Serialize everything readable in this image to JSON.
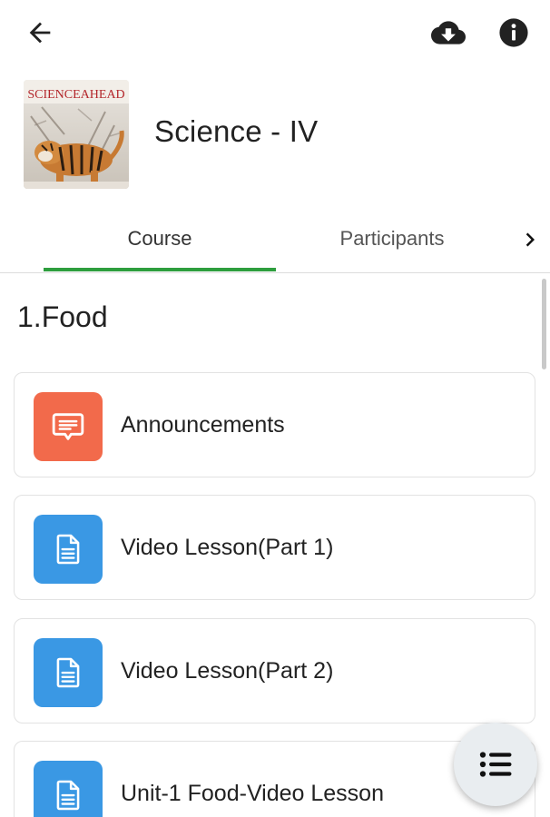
{
  "topbar": {
    "back_icon": "arrow-left-icon",
    "download_icon": "cloud-download-icon",
    "info_icon": "info-circle-icon"
  },
  "course": {
    "title": "Science - IV",
    "thumbnail_text": "SCIENCEAHEAD",
    "thumbnail_icon": "course-cover-image"
  },
  "tabs": {
    "items": [
      {
        "label": "Course",
        "active": true
      },
      {
        "label": "Participants",
        "active": false
      }
    ],
    "next_icon": "chevron-right-icon",
    "accent": "#2e9e3e"
  },
  "section": {
    "title": "1.Food"
  },
  "activities": [
    {
      "label": "Announcements",
      "icon": "forum-icon",
      "color": "#f26a4b"
    },
    {
      "label": "Video Lesson(Part 1)",
      "icon": "document-icon",
      "color": "#3a98e4"
    },
    {
      "label": "Video Lesson(Part 2)",
      "icon": "document-icon",
      "color": "#3a98e4"
    },
    {
      "label": "Unit-1 Food-Video Lesson",
      "icon": "document-icon",
      "color": "#3a98e4"
    }
  ],
  "fab": {
    "icon": "course-index-list-icon"
  }
}
